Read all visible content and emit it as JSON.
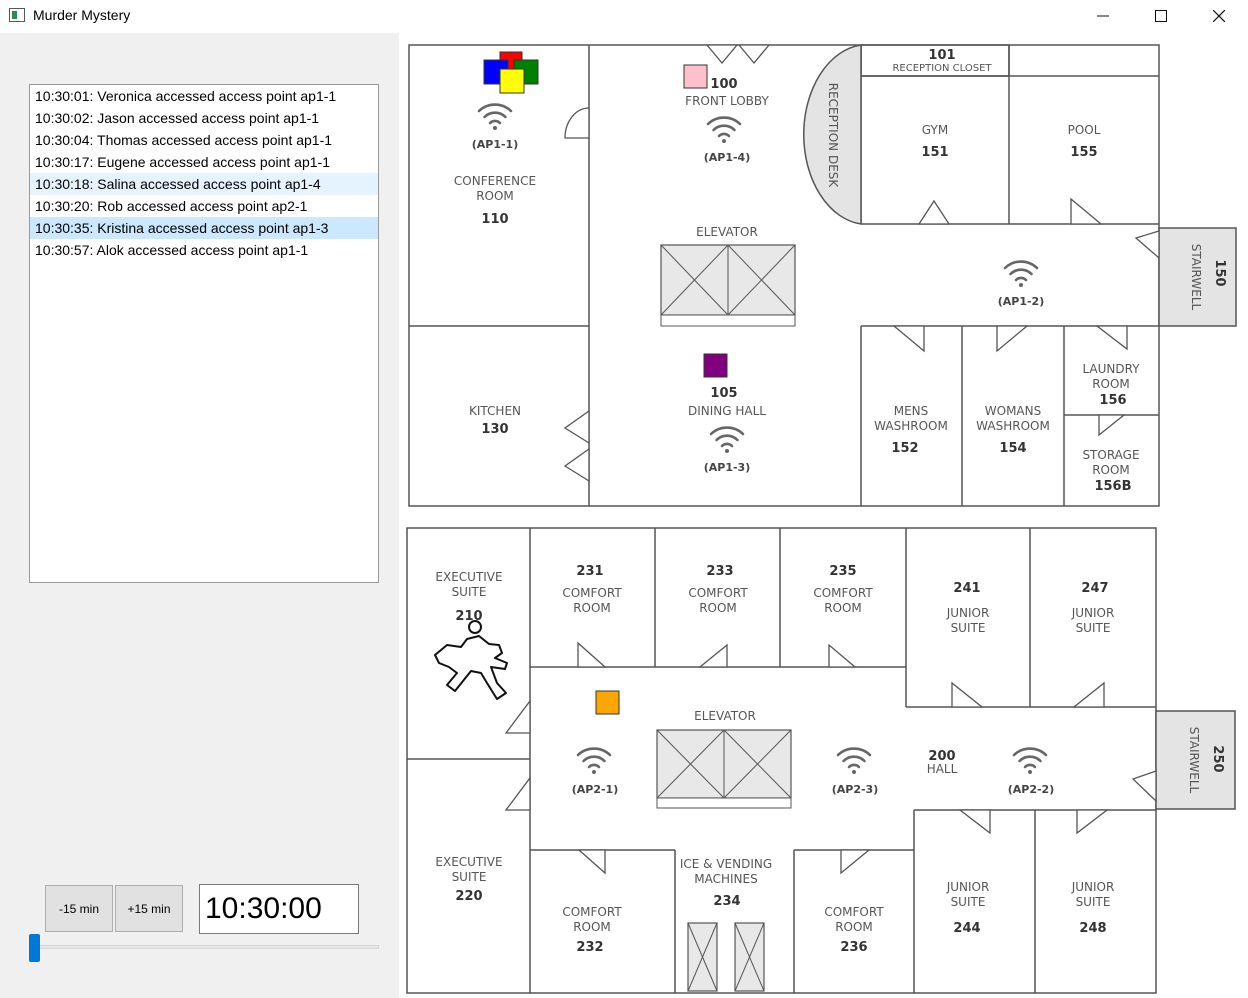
{
  "window": {
    "title": "Murder Mystery"
  },
  "log": {
    "entries": [
      "10:30:01: Veronica accessed access point ap1-1",
      "10:30:02: Jason accessed access point ap1-1",
      "10:30:04: Thomas accessed access point ap1-1",
      "10:30:17: Eugene accessed access point ap1-1",
      "10:30:18: Salina accessed access point ap1-4",
      "10:30:20: Rob accessed access point ap2-1",
      "10:30:35: Kristina accessed access point ap1-3",
      "10:30:57: Alok accessed access point ap1-1"
    ],
    "hovered_index": 4,
    "selected_index": 6
  },
  "controls": {
    "minus_label": "-15 min",
    "plus_label": "+15 min",
    "time": "10:30:00",
    "slider_position": 0
  },
  "floor1": {
    "rooms": {
      "r101": {
        "num": "101",
        "name": "RECEPTION CLOSET"
      },
      "r100": {
        "num": "100",
        "name": "FRONT LOBBY"
      },
      "r110": {
        "num": "110",
        "name1": "CONFERENCE",
        "name2": "ROOM"
      },
      "r151": {
        "num": "151",
        "name": "GYM"
      },
      "r155": {
        "num": "155",
        "name": "POOL"
      },
      "reception": {
        "name": "RECEPTION DESK"
      },
      "elevator": {
        "name": "ELEVATOR"
      },
      "r150": {
        "num": "150",
        "name": "STAIRWELL"
      },
      "r130": {
        "num": "130",
        "name": "KITCHEN"
      },
      "r105": {
        "num": "105",
        "name": "DINING HALL"
      },
      "r152": {
        "num": "152",
        "name1": "MENS",
        "name2": "WASHROOM"
      },
      "r154": {
        "num": "154",
        "name1": "WOMANS",
        "name2": "WASHROOM"
      },
      "r156": {
        "num": "156",
        "name1": "LAUNDRY",
        "name2": "ROOM"
      },
      "r156b": {
        "num": "156B",
        "name1": "STORAGE",
        "name2": "ROOM"
      }
    },
    "access_points": {
      "ap11": "(AP1-1)",
      "ap12": "(AP1-2)",
      "ap13": "(AP1-3)",
      "ap14": "(AP1-4)"
    }
  },
  "floor2": {
    "rooms": {
      "r210": {
        "num": "210",
        "name1": "EXECUTIVE",
        "name2": "SUITE"
      },
      "r220": {
        "num": "220",
        "name1": "EXECUTIVE",
        "name2": "SUITE"
      },
      "r231": {
        "num": "231",
        "name1": "COMFORT",
        "name2": "ROOM"
      },
      "r233": {
        "num": "233",
        "name1": "COMFORT",
        "name2": "ROOM"
      },
      "r235": {
        "num": "235",
        "name1": "COMFORT",
        "name2": "ROOM"
      },
      "r241": {
        "num": "241",
        "name1": "JUNIOR",
        "name2": "SUITE"
      },
      "r247": {
        "num": "247",
        "name1": "JUNIOR",
        "name2": "SUITE"
      },
      "r200": {
        "num": "200",
        "name": "HALL"
      },
      "elevator": {
        "name": "ELEVATOR"
      },
      "r250": {
        "num": "250",
        "name": "STAIRWELL"
      },
      "r232": {
        "num": "232",
        "name1": "COMFORT",
        "name2": "ROOM"
      },
      "r234": {
        "num": "234",
        "name1": "ICE & VENDING",
        "name2": "MACHINES"
      },
      "r236": {
        "num": "236",
        "name1": "COMFORT",
        "name2": "ROOM"
      },
      "r244": {
        "num": "244",
        "name1": "JUNIOR",
        "name2": "SUITE"
      },
      "r248": {
        "num": "248",
        "name1": "JUNIOR",
        "name2": "SUITE"
      }
    },
    "access_points": {
      "ap21": "(AP2-1)",
      "ap22": "(AP2-2)",
      "ap23": "(AP2-3)"
    }
  },
  "markers": [
    {
      "color": "#ff0000",
      "location": "ap1-1"
    },
    {
      "color": "#008000",
      "location": "ap1-1"
    },
    {
      "color": "#0000ff",
      "location": "ap1-1"
    },
    {
      "color": "#ffff00",
      "location": "ap1-1"
    },
    {
      "color": "#ffc0cb",
      "location": "ap1-4"
    },
    {
      "color": "#800080",
      "location": "ap1-3"
    },
    {
      "color": "#ffa500",
      "location": "ap2-1"
    }
  ],
  "icons": {
    "access_point": "wifi-icon",
    "victim": "chalk-outline-icon",
    "window_buttons": [
      "minimize-icon",
      "maximize-icon",
      "close-icon"
    ]
  }
}
